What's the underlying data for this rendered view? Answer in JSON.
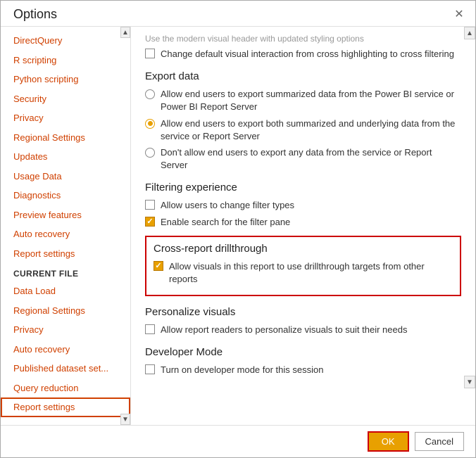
{
  "dialog": {
    "title": "Options",
    "close_label": "✕"
  },
  "sidebar": {
    "global_items": [
      {
        "label": "DirectQuery",
        "active": false
      },
      {
        "label": "R scripting",
        "active": false
      },
      {
        "label": "Python scripting",
        "active": false
      },
      {
        "label": "Security",
        "active": false
      },
      {
        "label": "Privacy",
        "active": false
      },
      {
        "label": "Regional Settings",
        "active": false
      },
      {
        "label": "Updates",
        "active": false
      },
      {
        "label": "Usage Data",
        "active": false
      },
      {
        "label": "Diagnostics",
        "active": false
      },
      {
        "label": "Preview features",
        "active": false
      },
      {
        "label": "Auto recovery",
        "active": false
      },
      {
        "label": "Report settings",
        "active": false
      }
    ],
    "current_file_header": "CURRENT FILE",
    "current_file_items": [
      {
        "label": "Data Load",
        "active": false
      },
      {
        "label": "Regional Settings",
        "active": false
      },
      {
        "label": "Privacy",
        "active": false
      },
      {
        "label": "Auto recovery",
        "active": false
      },
      {
        "label": "Published dataset set...",
        "active": false
      },
      {
        "label": "Query reduction",
        "active": false
      },
      {
        "label": "Report settings",
        "active": true
      }
    ]
  },
  "main": {
    "faded_top": "Use the modern visual header with updated styling options",
    "option_cross_filter": {
      "text": "Change default visual interaction from cross highlighting to cross filtering",
      "checked": false
    },
    "export_data_section": "Export data",
    "export_options": [
      {
        "text": "Allow end users to export summarized data from the Power BI service or Power BI Report Server",
        "type": "radio",
        "checked": false
      },
      {
        "text": "Allow end users to export both summarized and underlying data from the service or Report Server",
        "type": "radio",
        "checked": true
      },
      {
        "text": "Don't allow end users to export any data from the service or Report Server",
        "type": "radio",
        "checked": false
      }
    ],
    "filtering_section": "Filtering experience",
    "filter_options": [
      {
        "text": "Allow users to change filter types",
        "type": "checkbox",
        "checked": false
      },
      {
        "text": "Enable search for the filter pane",
        "type": "checkbox",
        "checked": true
      }
    ],
    "cross_report_section": "Cross-report drillthrough",
    "cross_report_option": {
      "text": "Allow visuals in this report to use drillthrough targets from other reports",
      "checked": true
    },
    "personalize_section": "Personalize visuals",
    "personalize_option": {
      "text": "Allow report readers to personalize visuals to suit their needs",
      "checked": false
    },
    "developer_section": "Developer Mode",
    "developer_option": {
      "text": "Turn on developer mode for this session",
      "checked": false
    }
  },
  "footer": {
    "ok_label": "OK",
    "cancel_label": "Cancel"
  }
}
